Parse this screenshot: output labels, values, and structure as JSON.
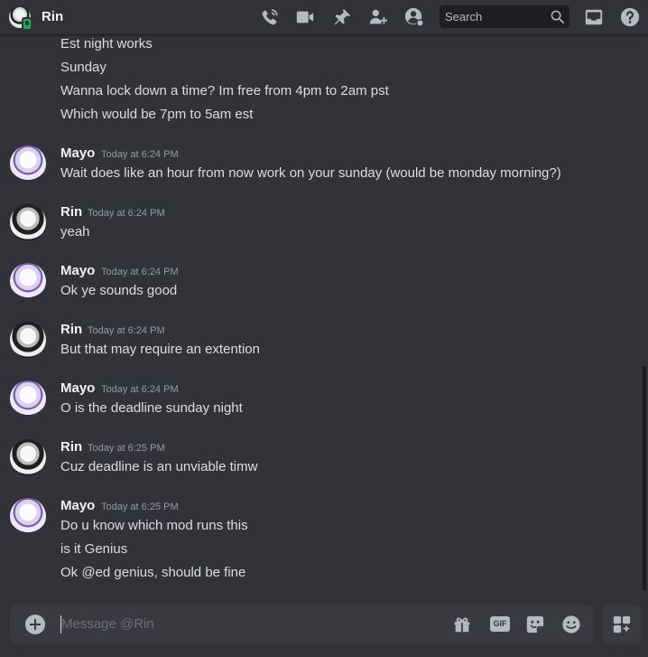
{
  "header": {
    "name": "Rin",
    "search_label": "Search"
  },
  "messages": {
    "continued": [
      "Est night works",
      "Sunday",
      "Wanna lock down a time? Im free from 4pm to 2am pst",
      "Which would be 7pm to 5am est"
    ],
    "groups": [
      {
        "author": "Mayo",
        "time": "Today at 6:24 PM",
        "lines": [
          "Wait does like an hour from now work on your sunday (would be monday morning?)"
        ]
      },
      {
        "author": "Rin",
        "time": "Today at 6:24 PM",
        "lines": [
          "yeah"
        ]
      },
      {
        "author": "Mayo",
        "time": "Today at 6:24 PM",
        "lines": [
          "Ok ye sounds good"
        ]
      },
      {
        "author": "Rin",
        "time": "Today at 6:24 PM",
        "lines": [
          "But that may require an extention"
        ]
      },
      {
        "author": "Mayo",
        "time": "Today at 6:24 PM",
        "lines": [
          "O is the deadline sunday night"
        ]
      },
      {
        "author": "Rin",
        "time": "Today at 6:25 PM",
        "lines": [
          "Cuz deadline is an unviable timw"
        ]
      },
      {
        "author": "Mayo",
        "time": "Today at 6:25 PM",
        "lines": [
          "Do u know which mod runs this",
          "is it Genius",
          "Ok @ed genius, should be fine"
        ]
      }
    ]
  },
  "composer": {
    "placeholder": "Message @Rin",
    "gif_label": "GIF"
  },
  "colors": {
    "background": "#313338",
    "composer": "#383a40",
    "online": "#23a55a",
    "icon": "#b5bac1",
    "timestamp": "#949ba4"
  },
  "icons": [
    "phone-icon",
    "video-icon",
    "pin-icon",
    "add-friend-icon",
    "profile-icon",
    "search-icon",
    "inbox-icon",
    "help-icon",
    "add-attachment-icon",
    "gift-icon",
    "gif-icon",
    "sticker-icon",
    "emoji-icon",
    "apps-icon"
  ]
}
